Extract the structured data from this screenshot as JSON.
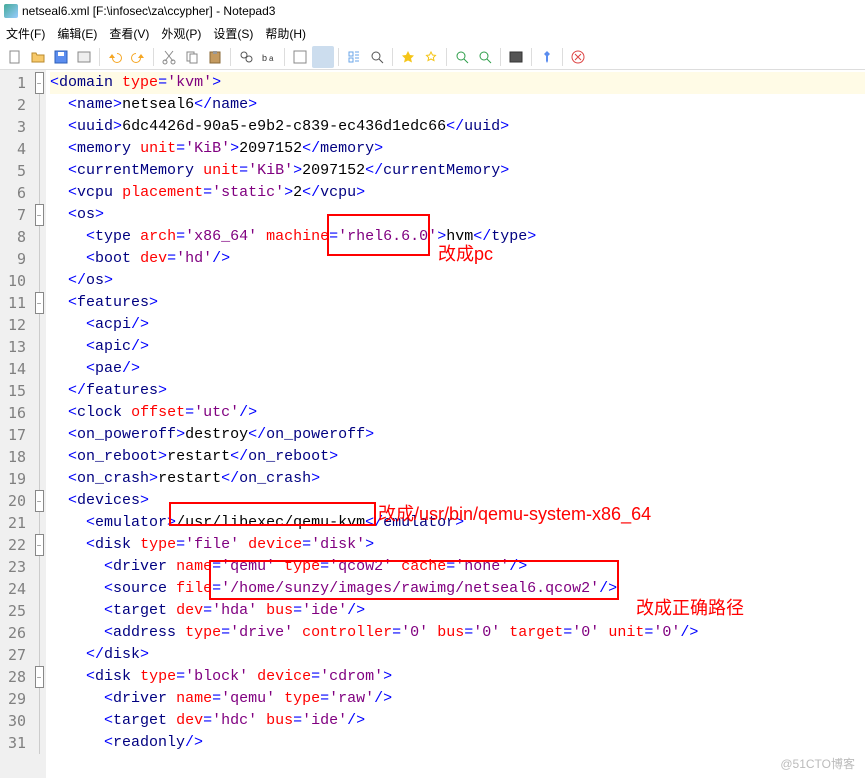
{
  "title": "netseal6.xml [F:\\infosec\\za\\ccypher] - Notepad3",
  "menu": {
    "file": "文件(F)",
    "edit": "编辑(E)",
    "view": "查看(V)",
    "appearance": "外观(P)",
    "settings": "设置(S)",
    "help": "帮助(H)"
  },
  "toolbar_icons": [
    "new-file-icon",
    "open-icon",
    "save-icon",
    "history-icon",
    "sep",
    "undo-icon",
    "redo-icon",
    "sep",
    "cut-icon",
    "copy-icon",
    "paste-icon",
    "sep",
    "find-icon",
    "replace-icon",
    "sep",
    "word-wrap-icon",
    "whitespace-icon",
    "sep",
    "indent-guides-icon",
    "zoom-icon",
    "sep",
    "bookmark-icon",
    "bookmark-clear-icon",
    "sep",
    "nav-prev-icon",
    "nav-next-icon",
    "sep",
    "fullscreen-icon",
    "sep",
    "pin-icon",
    "sep",
    "close-icon"
  ],
  "fold": {
    "1": "-",
    "7": "-",
    "11": "-",
    "20": "-",
    "22": "-",
    "28": "-"
  },
  "lines": [
    "<domain type='kvm'>",
    "  <name>netseal6</name>",
    "  <uuid>6dc4426d-90a5-e9b2-c839-ec436d1edc66</uuid>",
    "  <memory unit='KiB'>2097152</memory>",
    "  <currentMemory unit='KiB'>2097152</currentMemory>",
    "  <vcpu placement='static'>2</vcpu>",
    "  <os>",
    "    <type arch='x86_64' machine='rhel6.6.0'>hvm</type>",
    "    <boot dev='hd'/>",
    "  </os>",
    "  <features>",
    "    <acpi/>",
    "    <apic/>",
    "    <pae/>",
    "  </features>",
    "  <clock offset='utc'/>",
    "  <on_poweroff>destroy</on_poweroff>",
    "  <on_reboot>restart</on_reboot>",
    "  <on_crash>restart</on_crash>",
    "  <devices>",
    "    <emulator>/usr/libexec/qemu-kvm</emulator>",
    "    <disk type='file' device='disk'>",
    "      <driver name='qemu' type='qcow2' cache='none'/>",
    "      <source file='/home/sunzy/images/rawimg/netseal6.qcow2'/>",
    "      <target dev='hda' bus='ide'/>",
    "      <address type='drive' controller='0' bus='0' target='0' unit='0'/>",
    "    </disk>",
    "    <disk type='block' device='cdrom'>",
    "      <driver name='qemu' type='raw'/>",
    "      <target dev='hdc' bus='ide'/>",
    "      <readonly/>"
  ],
  "annotations": {
    "box1_label": "改成pc",
    "box2_label": "改成/usr/bin/qemu-system-x86_64",
    "box3_label": "改成正确路径"
  },
  "watermark": "@51CTO博客"
}
